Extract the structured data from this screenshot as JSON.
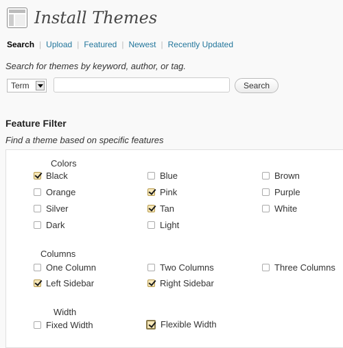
{
  "page": {
    "title": "Install Themes",
    "icon": "themes-icon"
  },
  "subnav": {
    "search": "Search",
    "upload": "Upload",
    "featured": "Featured",
    "newest": "Newest",
    "recently_updated": "Recently Updated",
    "separator": "|"
  },
  "search": {
    "description": "Search for themes by keyword, author, or tag.",
    "type_selected": "Term",
    "input_value": "",
    "button_label": "Search"
  },
  "feature_filter": {
    "title": "Feature Filter",
    "description": "Find a theme based on specific features",
    "colors": {
      "label": "Colors",
      "black": {
        "label": "Black",
        "checked": true
      },
      "blue": {
        "label": "Blue",
        "checked": false
      },
      "brown": {
        "label": "Brown",
        "checked": false
      },
      "orange": {
        "label": "Orange",
        "checked": false
      },
      "pink": {
        "label": "Pink",
        "checked": true
      },
      "purple": {
        "label": "Purple",
        "checked": false
      },
      "silver": {
        "label": "Silver",
        "checked": false
      },
      "tan": {
        "label": "Tan",
        "checked": true
      },
      "white": {
        "label": "White",
        "checked": false
      },
      "dark": {
        "label": "Dark",
        "checked": false
      },
      "light": {
        "label": "Light",
        "checked": false
      }
    },
    "columns": {
      "label": "Columns",
      "one_column": {
        "label": "One Column",
        "checked": false
      },
      "two_columns": {
        "label": "Two Columns",
        "checked": false
      },
      "three_columns": {
        "label": "Three Columns",
        "checked": false
      },
      "left_sidebar": {
        "label": "Left Sidebar",
        "checked": true
      },
      "right_sidebar": {
        "label": "Right Sidebar",
        "checked": true
      }
    },
    "width": {
      "label": "Width",
      "fixed_width": {
        "label": "Fixed Width",
        "checked": false
      },
      "flexible_width": {
        "label": "Flexible Width",
        "checked": true
      }
    }
  }
}
